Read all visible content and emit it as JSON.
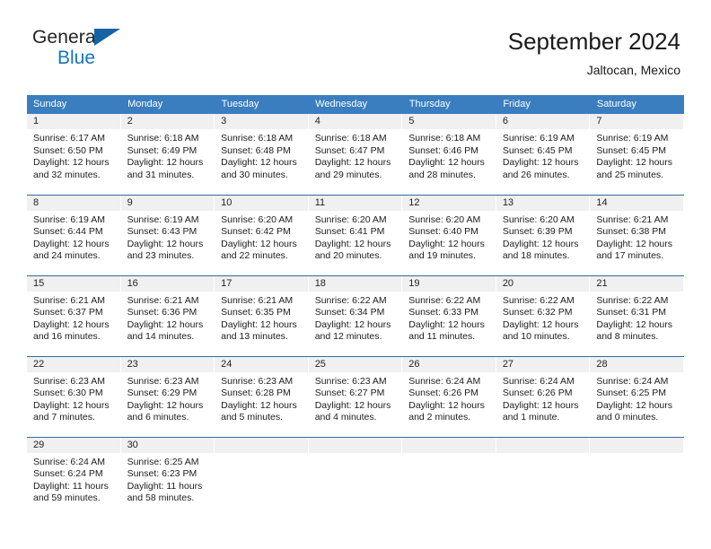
{
  "brand": {
    "line1": "General",
    "line2": "Blue",
    "flag_color": "#1464a5",
    "line2_color": "#1874bd"
  },
  "header": {
    "title": "September 2024",
    "subtitle": "Jaltocan, Mexico"
  },
  "theme": {
    "header_row_bg": "#3a7ebf",
    "row_divider": "#2e6da4",
    "daynum_band_bg": "#f0f0f0",
    "text": "#1c1c1c"
  },
  "weekday_headers": [
    "Sunday",
    "Monday",
    "Tuesday",
    "Wednesday",
    "Thursday",
    "Friday",
    "Saturday"
  ],
  "weeks": [
    [
      {
        "day": "1",
        "sunrise": "Sunrise: 6:17 AM",
        "sunset": "Sunset: 6:50 PM",
        "daylight1": "Daylight: 12 hours",
        "daylight2": "and 32 minutes."
      },
      {
        "day": "2",
        "sunrise": "Sunrise: 6:18 AM",
        "sunset": "Sunset: 6:49 PM",
        "daylight1": "Daylight: 12 hours",
        "daylight2": "and 31 minutes."
      },
      {
        "day": "3",
        "sunrise": "Sunrise: 6:18 AM",
        "sunset": "Sunset: 6:48 PM",
        "daylight1": "Daylight: 12 hours",
        "daylight2": "and 30 minutes."
      },
      {
        "day": "4",
        "sunrise": "Sunrise: 6:18 AM",
        "sunset": "Sunset: 6:47 PM",
        "daylight1": "Daylight: 12 hours",
        "daylight2": "and 29 minutes."
      },
      {
        "day": "5",
        "sunrise": "Sunrise: 6:18 AM",
        "sunset": "Sunset: 6:46 PM",
        "daylight1": "Daylight: 12 hours",
        "daylight2": "and 28 minutes."
      },
      {
        "day": "6",
        "sunrise": "Sunrise: 6:19 AM",
        "sunset": "Sunset: 6:45 PM",
        "daylight1": "Daylight: 12 hours",
        "daylight2": "and 26 minutes."
      },
      {
        "day": "7",
        "sunrise": "Sunrise: 6:19 AM",
        "sunset": "Sunset: 6:45 PM",
        "daylight1": "Daylight: 12 hours",
        "daylight2": "and 25 minutes."
      }
    ],
    [
      {
        "day": "8",
        "sunrise": "Sunrise: 6:19 AM",
        "sunset": "Sunset: 6:44 PM",
        "daylight1": "Daylight: 12 hours",
        "daylight2": "and 24 minutes."
      },
      {
        "day": "9",
        "sunrise": "Sunrise: 6:19 AM",
        "sunset": "Sunset: 6:43 PM",
        "daylight1": "Daylight: 12 hours",
        "daylight2": "and 23 minutes."
      },
      {
        "day": "10",
        "sunrise": "Sunrise: 6:20 AM",
        "sunset": "Sunset: 6:42 PM",
        "daylight1": "Daylight: 12 hours",
        "daylight2": "and 22 minutes."
      },
      {
        "day": "11",
        "sunrise": "Sunrise: 6:20 AM",
        "sunset": "Sunset: 6:41 PM",
        "daylight1": "Daylight: 12 hours",
        "daylight2": "and 20 minutes."
      },
      {
        "day": "12",
        "sunrise": "Sunrise: 6:20 AM",
        "sunset": "Sunset: 6:40 PM",
        "daylight1": "Daylight: 12 hours",
        "daylight2": "and 19 minutes."
      },
      {
        "day": "13",
        "sunrise": "Sunrise: 6:20 AM",
        "sunset": "Sunset: 6:39 PM",
        "daylight1": "Daylight: 12 hours",
        "daylight2": "and 18 minutes."
      },
      {
        "day": "14",
        "sunrise": "Sunrise: 6:21 AM",
        "sunset": "Sunset: 6:38 PM",
        "daylight1": "Daylight: 12 hours",
        "daylight2": "and 17 minutes."
      }
    ],
    [
      {
        "day": "15",
        "sunrise": "Sunrise: 6:21 AM",
        "sunset": "Sunset: 6:37 PM",
        "daylight1": "Daylight: 12 hours",
        "daylight2": "and 16 minutes."
      },
      {
        "day": "16",
        "sunrise": "Sunrise: 6:21 AM",
        "sunset": "Sunset: 6:36 PM",
        "daylight1": "Daylight: 12 hours",
        "daylight2": "and 14 minutes."
      },
      {
        "day": "17",
        "sunrise": "Sunrise: 6:21 AM",
        "sunset": "Sunset: 6:35 PM",
        "daylight1": "Daylight: 12 hours",
        "daylight2": "and 13 minutes."
      },
      {
        "day": "18",
        "sunrise": "Sunrise: 6:22 AM",
        "sunset": "Sunset: 6:34 PM",
        "daylight1": "Daylight: 12 hours",
        "daylight2": "and 12 minutes."
      },
      {
        "day": "19",
        "sunrise": "Sunrise: 6:22 AM",
        "sunset": "Sunset: 6:33 PM",
        "daylight1": "Daylight: 12 hours",
        "daylight2": "and 11 minutes."
      },
      {
        "day": "20",
        "sunrise": "Sunrise: 6:22 AM",
        "sunset": "Sunset: 6:32 PM",
        "daylight1": "Daylight: 12 hours",
        "daylight2": "and 10 minutes."
      },
      {
        "day": "21",
        "sunrise": "Sunrise: 6:22 AM",
        "sunset": "Sunset: 6:31 PM",
        "daylight1": "Daylight: 12 hours",
        "daylight2": "and 8 minutes."
      }
    ],
    [
      {
        "day": "22",
        "sunrise": "Sunrise: 6:23 AM",
        "sunset": "Sunset: 6:30 PM",
        "daylight1": "Daylight: 12 hours",
        "daylight2": "and 7 minutes."
      },
      {
        "day": "23",
        "sunrise": "Sunrise: 6:23 AM",
        "sunset": "Sunset: 6:29 PM",
        "daylight1": "Daylight: 12 hours",
        "daylight2": "and 6 minutes."
      },
      {
        "day": "24",
        "sunrise": "Sunrise: 6:23 AM",
        "sunset": "Sunset: 6:28 PM",
        "daylight1": "Daylight: 12 hours",
        "daylight2": "and 5 minutes."
      },
      {
        "day": "25",
        "sunrise": "Sunrise: 6:23 AM",
        "sunset": "Sunset: 6:27 PM",
        "daylight1": "Daylight: 12 hours",
        "daylight2": "and 4 minutes."
      },
      {
        "day": "26",
        "sunrise": "Sunrise: 6:24 AM",
        "sunset": "Sunset: 6:26 PM",
        "daylight1": "Daylight: 12 hours",
        "daylight2": "and 2 minutes."
      },
      {
        "day": "27",
        "sunrise": "Sunrise: 6:24 AM",
        "sunset": "Sunset: 6:26 PM",
        "daylight1": "Daylight: 12 hours",
        "daylight2": "and 1 minute."
      },
      {
        "day": "28",
        "sunrise": "Sunrise: 6:24 AM",
        "sunset": "Sunset: 6:25 PM",
        "daylight1": "Daylight: 12 hours",
        "daylight2": "and 0 minutes."
      }
    ],
    [
      {
        "day": "29",
        "sunrise": "Sunrise: 6:24 AM",
        "sunset": "Sunset: 6:24 PM",
        "daylight1": "Daylight: 11 hours",
        "daylight2": "and 59 minutes."
      },
      {
        "day": "30",
        "sunrise": "Sunrise: 6:25 AM",
        "sunset": "Sunset: 6:23 PM",
        "daylight1": "Daylight: 11 hours",
        "daylight2": "and 58 minutes."
      },
      {
        "day": "",
        "sunrise": "",
        "sunset": "",
        "daylight1": "",
        "daylight2": ""
      },
      {
        "day": "",
        "sunrise": "",
        "sunset": "",
        "daylight1": "",
        "daylight2": ""
      },
      {
        "day": "",
        "sunrise": "",
        "sunset": "",
        "daylight1": "",
        "daylight2": ""
      },
      {
        "day": "",
        "sunrise": "",
        "sunset": "",
        "daylight1": "",
        "daylight2": ""
      },
      {
        "day": "",
        "sunrise": "",
        "sunset": "",
        "daylight1": "",
        "daylight2": ""
      }
    ]
  ]
}
